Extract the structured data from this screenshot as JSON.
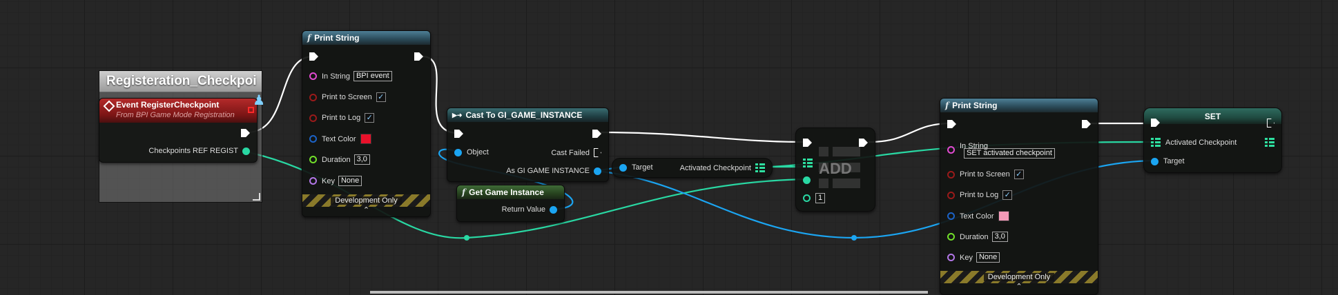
{
  "comment_box": {
    "title": "Registeration_Checkpoi"
  },
  "event_node": {
    "title": "Event RegisterCheckpoint",
    "subtitle": "From BPI Game Mode Registration",
    "out_pin": "Checkpoints REF REGIST"
  },
  "print1": {
    "title": "Print String",
    "in_string_label": "In String",
    "in_string_value": "BPI event",
    "print_to_screen": "Print to Screen",
    "print_to_log": "Print to Log",
    "text_color": "Text Color",
    "duration_label": "Duration",
    "duration_value": "3,0",
    "key_label": "Key",
    "key_value": "None",
    "dev_only": "Development Only",
    "color_value": "#e8112a",
    "checkmark": "✓"
  },
  "cast": {
    "title": "Cast To GI_GAME_INSTANCE",
    "object": "Object",
    "cast_failed": "Cast Failed",
    "as_gi": "As GI GAME INSTANCE"
  },
  "get_gi": {
    "title": "Get Game Instance",
    "return_value": "Return Value"
  },
  "getter": {
    "target": "Target",
    "activated": "Activated Checkpoint"
  },
  "add_node": {
    "label": "ADD",
    "index_value": "1"
  },
  "print2": {
    "title": "Print String",
    "in_string_label": "In String",
    "in_string_value": "SET activated checkpoint",
    "print_to_screen": "Print to Screen",
    "print_to_log": "Print to Log",
    "text_color": "Text Color",
    "duration_label": "Duration",
    "duration_value": "3,0",
    "key_label": "Key",
    "key_value": "None",
    "dev_only": "Development Only",
    "color_value": "#f49ab8",
    "checkmark": "✓"
  },
  "set_node": {
    "title": "SET",
    "activated": "Activated Checkpoint",
    "target": "Target"
  },
  "colors": {
    "exec": "#ffffff",
    "object": "#1ba5f2",
    "string": "#e24ad1",
    "bool": "#9a1a1a",
    "color": "#1c63c7",
    "float": "#72e02a",
    "name": "#b377e8",
    "array": "#29d8a3"
  }
}
